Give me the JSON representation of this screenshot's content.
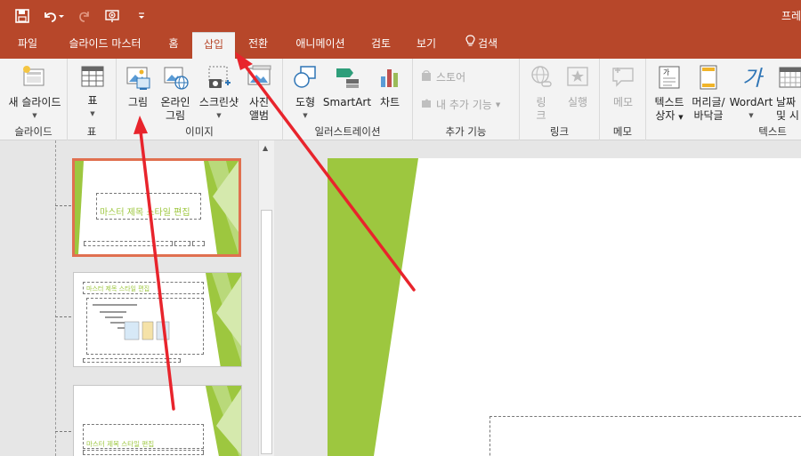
{
  "titlebar": {
    "text": "프레",
    "qat": [
      {
        "icon": "save-icon"
      },
      {
        "icon": "undo-icon"
      },
      {
        "icon": "redo-icon"
      },
      {
        "icon": "start-from-beginning-icon"
      },
      {
        "icon": "customize-qat-icon"
      }
    ]
  },
  "tabs": [
    {
      "label": "파일"
    },
    {
      "label": "슬라이드 마스터"
    },
    {
      "label": "홈"
    },
    {
      "label": "삽입"
    },
    {
      "label": "전환"
    },
    {
      "label": "애니메이션"
    },
    {
      "label": "검토"
    },
    {
      "label": "보기"
    },
    {
      "label": "검색"
    }
  ],
  "ribbon": {
    "groups": {
      "slide": {
        "label": "슬라이드",
        "new_slide": "새 슬라이드"
      },
      "table": {
        "label": "표",
        "table": "표"
      },
      "images": {
        "label": "이미지",
        "picture": "그림",
        "online_picture_1": "온라인",
        "online_picture_2": "그림",
        "screenshot": "스크린샷",
        "album_1": "사진",
        "album_2": "앨범"
      },
      "illustrations": {
        "label": "일러스트레이션",
        "shapes": "도형",
        "smartart": "SmartArt",
        "chart": "차트"
      },
      "addins": {
        "label": "추가 기능",
        "store": "스토어",
        "my_addins": "내 추가 기능"
      },
      "links": {
        "label": "링크",
        "link_1": "링",
        "link_2": "크",
        "action": "실행"
      },
      "comments": {
        "label": "메모",
        "comment": "메모"
      },
      "text": {
        "label": "텍스트",
        "textbox_1": "텍스트",
        "textbox_2": "상자",
        "header_1": "머리글/",
        "header_2": "바닥글",
        "wordart": "WordArt",
        "datetime_1": "날짜",
        "datetime_2": "및 시"
      }
    }
  },
  "thumbnails": [
    {
      "title": "마스터 제목 스타일 편집"
    },
    {
      "title": "마스터 제목 스타일 편집"
    },
    {
      "title": "마스터 제목 스타일 편집"
    }
  ],
  "colors": {
    "accent": "#b7472a",
    "green": "#9dc73f",
    "selection": "#e07050",
    "arrow": "#e8242c"
  }
}
